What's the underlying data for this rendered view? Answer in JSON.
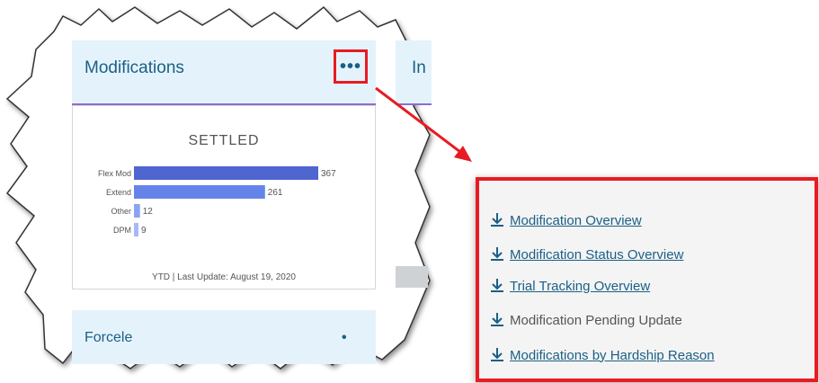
{
  "card": {
    "title": "Modifications",
    "more_label": "•••"
  },
  "side_card": {
    "title_fragment": "In"
  },
  "bottom_card": {
    "title": "Forcele",
    "dots": "•"
  },
  "chart_data": {
    "type": "bar",
    "orientation": "horizontal",
    "title": "SETTLED",
    "categories": [
      "Flex Mod",
      "Extend",
      "Other",
      "DPM"
    ],
    "values": [
      367,
      261,
      12,
      9
    ],
    "colors": [
      "#4f65cf",
      "#6584ea",
      "#8aa3f2",
      "#a7b8f6"
    ],
    "footer": "YTD | Last Update: August 19, 2020"
  },
  "menu": {
    "items": [
      {
        "label": "Modification Overview",
        "link": true
      },
      {
        "label": "Modification Status Overview",
        "link": true
      },
      {
        "label": "Trial Tracking Overview",
        "link": true
      },
      {
        "label": "Modification Pending Update",
        "link": false
      },
      {
        "label": "Modifications by Hardship Reason",
        "link": true
      }
    ]
  },
  "colors": {
    "accent": "#1b5f86",
    "highlight": "#e81b23",
    "header_bg": "#e4f3fb",
    "divider": "#8e6bd3"
  }
}
